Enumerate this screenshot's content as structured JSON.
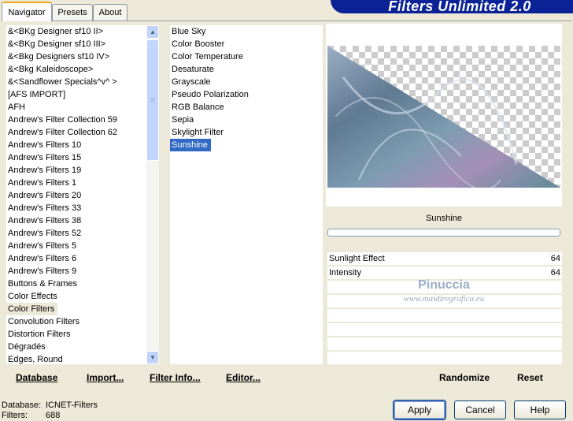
{
  "tabs": [
    {
      "label": "Navigator"
    },
    {
      "label": "Presets"
    },
    {
      "label": "About"
    }
  ],
  "banner": {
    "title": "Filters Unlimited 2.0"
  },
  "categories": [
    "&<BKg Designer sf10 II>",
    "&<BKg Designer sf10 III>",
    "&<Bkg Designers sf10 IV>",
    "&<Bkg Kaleidoscope>",
    "&<Sandflower Specials^v^ >",
    "[AFS IMPORT]",
    "AFH",
    "Andrew's Filter Collection 59",
    "Andrew's Filter Collection 62",
    "Andrew's Filters 10",
    "Andrew's Filters 15",
    "Andrew's Filters 19",
    "Andrew's Filters 1",
    "Andrew's Filters 20",
    "Andrew's Filters 33",
    "Andrew's Filters 38",
    "Andrew's Filters 52",
    "Andrew's Filters 5",
    "Andrew's Filters 6",
    "Andrew's Filters 9",
    "Buttons & Frames",
    "Color Effects",
    "Color Filters",
    "Convolution Filters",
    "Distortion Filters",
    "Dégradés",
    "Edges, Round"
  ],
  "selected_category": "Color Filters",
  "filters": [
    "Blue Sky",
    "Color Booster",
    "Color Temperature",
    "Desaturate",
    "Grayscale",
    "Pseudo Polarization",
    "RGB Balance",
    "Sepia",
    "Skylight Filter",
    "Sunshine"
  ],
  "selected_filter": "Sunshine",
  "filter_name": "Sunshine",
  "params": [
    {
      "label": "Sunlight Effect",
      "value": "64"
    },
    {
      "label": "Intensity",
      "value": "64"
    }
  ],
  "watermark": {
    "line1": "Pinuccia",
    "line2": "www.maidiregrafica.eu"
  },
  "left_actions": {
    "database": "Database",
    "import": "Import...",
    "filter_info": "Filter Info...",
    "editor": "Editor..."
  },
  "right_actions": {
    "randomize": "Randomize",
    "reset": "Reset"
  },
  "status": {
    "database_label": "Database:",
    "database_value": "ICNET-Filters",
    "filters_label": "Filters:",
    "filters_value": "688"
  },
  "buttons": {
    "apply": "Apply",
    "cancel": "Cancel",
    "help": "Help"
  },
  "colors": {
    "selection": "#316ac5",
    "banner": "#0a2296",
    "face": "#ece9d8"
  }
}
